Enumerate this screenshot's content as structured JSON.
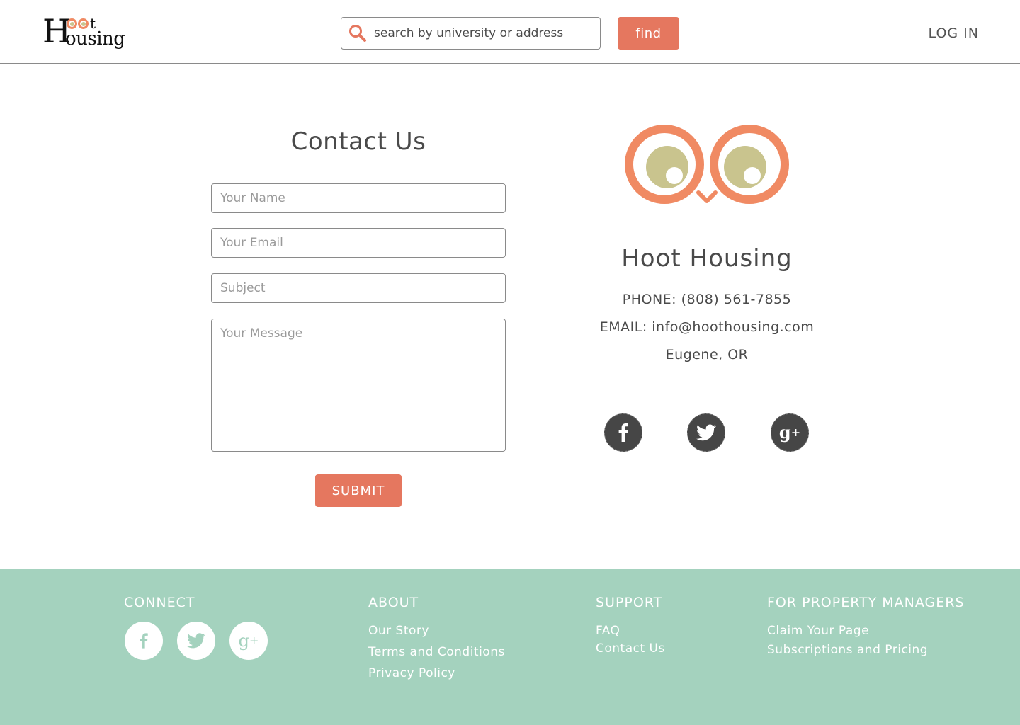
{
  "header": {
    "logo_alt": "Hoot Housing",
    "search_placeholder": "search by university or address",
    "find_label": "find",
    "login_label": "LOG IN"
  },
  "contact_form": {
    "title": "Contact Us",
    "name_placeholder": "Your Name",
    "email_placeholder": "Your Email",
    "subject_placeholder": "Subject",
    "message_placeholder": "Your Message",
    "submit_label": "SUBMIT"
  },
  "company_info": {
    "name": "Hoot Housing",
    "phone": "PHONE: (808) 561-7855",
    "email": "EMAIL: info@hoothousing.com",
    "location": "Eugene, OR",
    "social_icons": [
      "facebook-icon",
      "twitter-icon",
      "google-plus-icon"
    ]
  },
  "footer": {
    "connect": {
      "heading": "CONNECT",
      "icons": [
        "facebook-icon",
        "twitter-icon",
        "google-plus-icon"
      ]
    },
    "about": {
      "heading": "ABOUT",
      "links": [
        "Our Story",
        "Terms and Conditions",
        "Privacy Policy"
      ]
    },
    "support": {
      "heading": "SUPPORT",
      "links": [
        "FAQ",
        "Contact Us"
      ]
    },
    "property_managers": {
      "heading": "FOR PROPERTY MANAGERS",
      "links": [
        "Claim Your Page",
        "Subscriptions and Pricing"
      ]
    }
  },
  "colors": {
    "accent": "#e5775f",
    "owl_ring": "#f08a63",
    "owl_pupil": "#c9c48e",
    "footer_bg": "#a4d2be",
    "text": "#4a4a4a",
    "social_dark": "#464646"
  }
}
